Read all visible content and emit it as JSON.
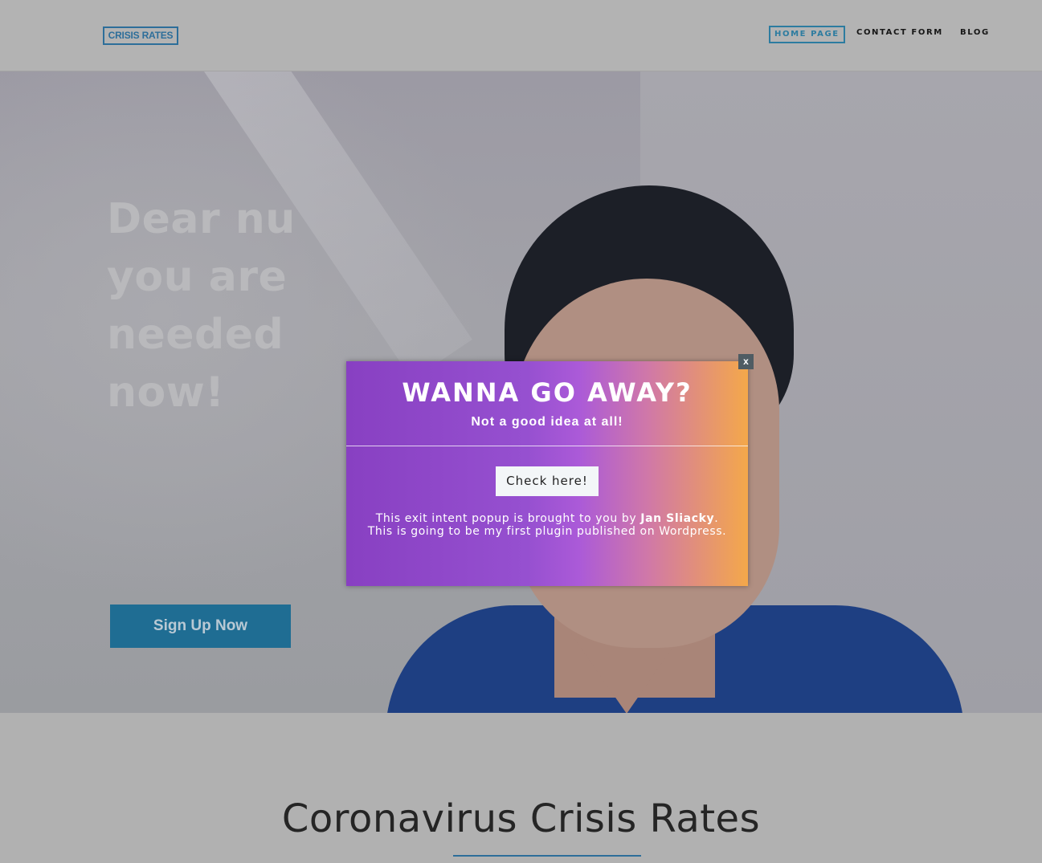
{
  "header": {
    "logo": "CRISIS RATES",
    "nav": [
      {
        "label": "HOME PAGE",
        "active": true
      },
      {
        "label": "CONTACT FORM",
        "active": false
      },
      {
        "label": "BLOG",
        "active": false
      }
    ]
  },
  "hero": {
    "title_lines": [
      "Dear nu",
      "you are",
      "needed",
      "now!"
    ],
    "cta_label": "Sign Up Now"
  },
  "section": {
    "title": "Coronavirus Crisis Rates"
  },
  "popup": {
    "close_label": "x",
    "title": "WANNA GO AWAY?",
    "subtitle": "Not a good idea at all!",
    "button_label": "Check here!",
    "text_before": "This exit intent popup is brought to you by ",
    "author": "Jan Sliacky",
    "text_after": ". This is going to be my first plugin published on Wordpress."
  },
  "colors": {
    "accent": "#2d7ca0",
    "popup_gradient_start": "#8840c2",
    "popup_gradient_end": "#f4a84a"
  }
}
